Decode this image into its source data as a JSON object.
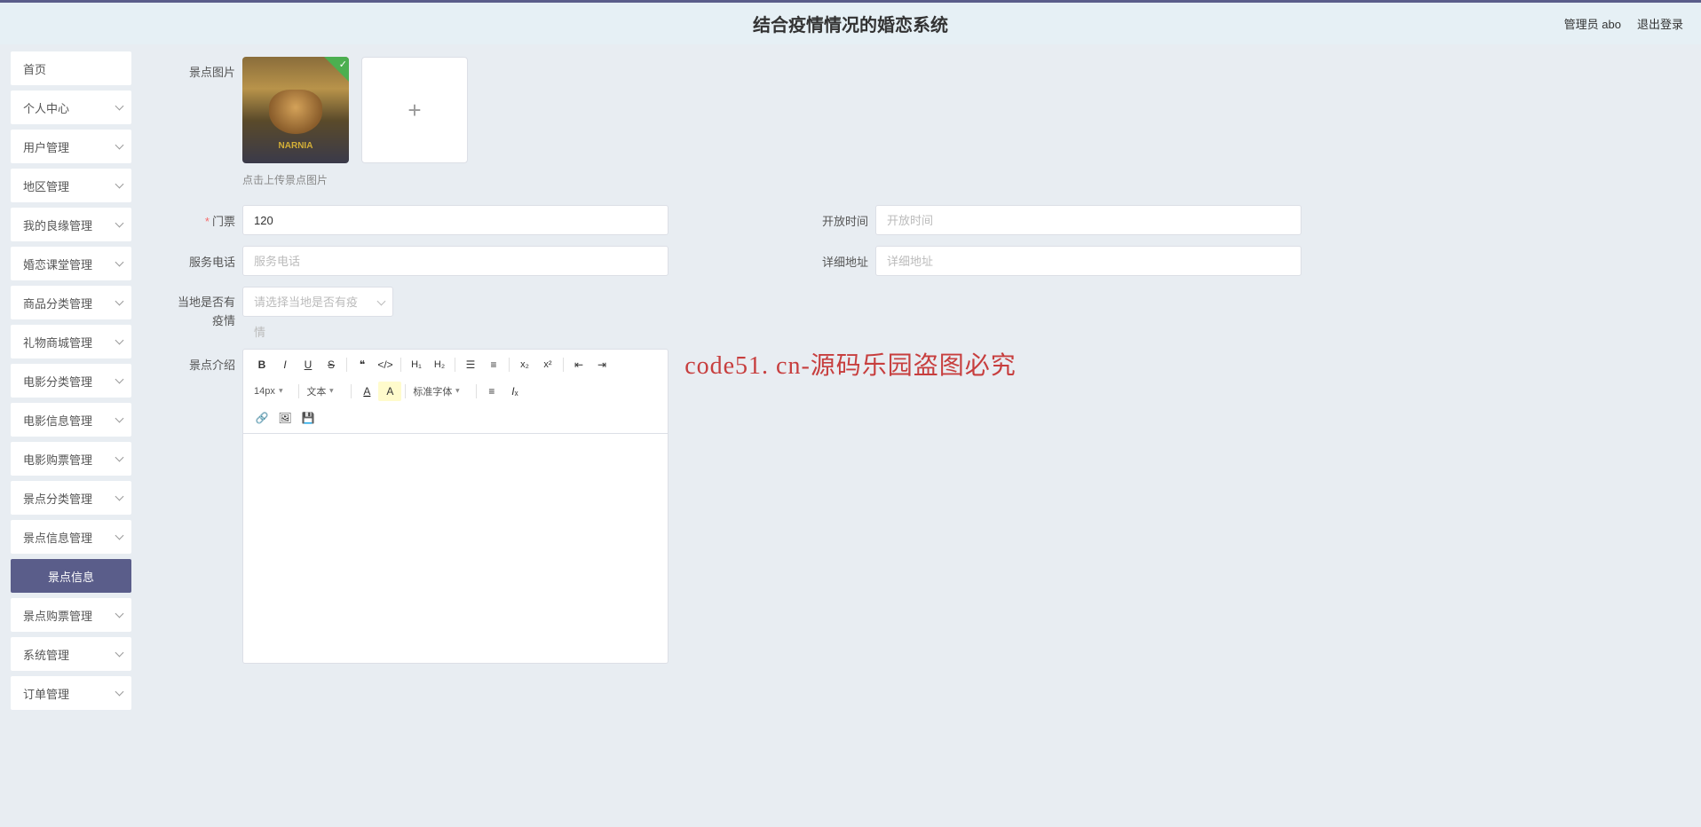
{
  "header": {
    "title": "结合疫情情况的婚恋系统",
    "user_label": "管理员 abo",
    "logout": "退出登录"
  },
  "sidebar": {
    "items": [
      {
        "label": "首页",
        "children": false
      },
      {
        "label": "个人中心",
        "children": true
      },
      {
        "label": "用户管理",
        "children": true
      },
      {
        "label": "地区管理",
        "children": true
      },
      {
        "label": "我的良缘管理",
        "children": true
      },
      {
        "label": "婚恋课堂管理",
        "children": true
      },
      {
        "label": "商品分类管理",
        "children": true
      },
      {
        "label": "礼物商城管理",
        "children": true
      },
      {
        "label": "电影分类管理",
        "children": true
      },
      {
        "label": "电影信息管理",
        "children": true
      },
      {
        "label": "电影购票管理",
        "children": true
      },
      {
        "label": "景点分类管理",
        "children": true
      },
      {
        "label": "景点信息管理",
        "children": true
      },
      {
        "label": "景点信息",
        "children": false,
        "active": true
      },
      {
        "label": "景点购票管理",
        "children": true
      },
      {
        "label": "系统管理",
        "children": true
      },
      {
        "label": "订单管理",
        "children": true
      }
    ]
  },
  "form": {
    "image_label": "景点图片",
    "upload_hint": "点击上传景点图片",
    "ticket": {
      "label": "门票",
      "value": "120",
      "required": true
    },
    "open_time": {
      "label": "开放时间",
      "placeholder": "开放时间",
      "value": ""
    },
    "phone": {
      "label": "服务电话",
      "placeholder": "服务电话",
      "value": ""
    },
    "address": {
      "label": "详细地址",
      "placeholder": "详细地址",
      "value": ""
    },
    "covid": {
      "label": "当地是否有疫情",
      "placeholder": "请选择当地是否有疫情"
    },
    "intro": {
      "label": "景点介绍"
    }
  },
  "editor_toolbar": {
    "font_size": "14px",
    "text_menu": "文本",
    "font_family": "标准字体"
  },
  "watermark": "code51. cn-源码乐园盗图必究",
  "thumb_caption": "NARNIA"
}
